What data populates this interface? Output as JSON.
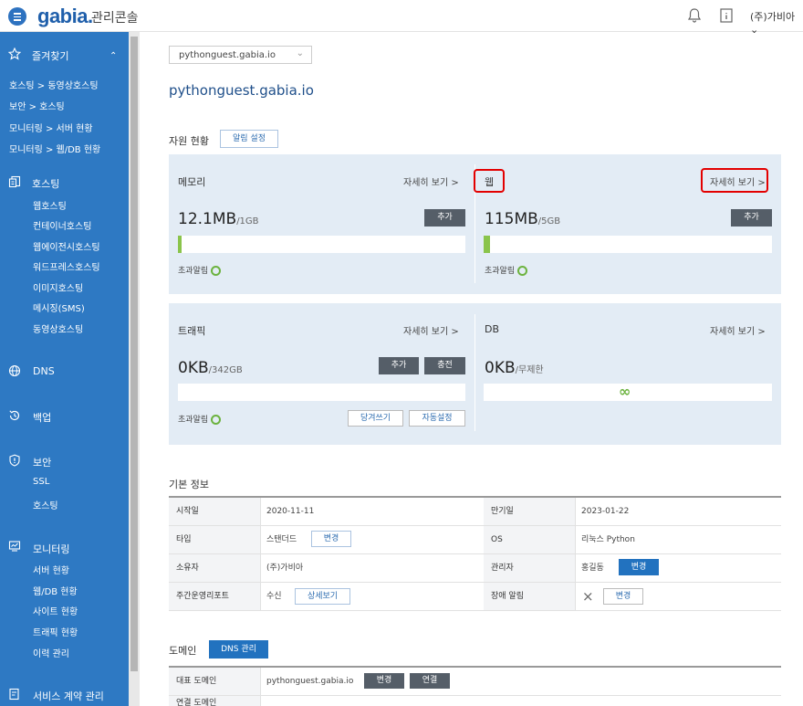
{
  "header": {
    "logo": "gabia.",
    "app_title": "관리콘솔",
    "user": "(주)가비아"
  },
  "sidebar": {
    "favorites": {
      "label": "즐겨찾기",
      "items": [
        "호스팅 > 동영상호스팅",
        "보안 > 호스팅",
        "모니터링 > 서버 현황",
        "모니터링 > 웹/DB 현황"
      ]
    },
    "hosting": {
      "label": "호스팅",
      "items": [
        "웹호스팅",
        "컨테이너호스팅",
        "웹에이전시호스팅",
        "워드프레스호스팅",
        "이미지호스팅",
        "메시징(SMS)",
        "동영상호스팅"
      ]
    },
    "dns": {
      "label": "DNS"
    },
    "backup": {
      "label": "백업"
    },
    "security": {
      "label": "보안",
      "items": [
        "SSL",
        "호스팅"
      ]
    },
    "monitoring": {
      "label": "모니터링",
      "items": [
        "서버 현황",
        "웹/DB 현황",
        "사이트 현황",
        "트래픽 현황",
        "이력 관리"
      ]
    },
    "contract": {
      "label": "서비스 계약 관리"
    }
  },
  "main": {
    "site_select": "pythonguest.gabia.io",
    "page_title": "pythonguest.gabia.io",
    "resources": {
      "title": "자원 현황",
      "alarm_settings": "알림 설정",
      "detail_link": "자세히 보기 >",
      "memory": {
        "label": "메모리",
        "value": "12.1MB",
        "limit": "/1GB",
        "add": "추가",
        "alarm": "초과알림",
        "usage": 0.012
      },
      "web": {
        "label": "웹",
        "value": "115MB",
        "limit": "/5GB",
        "add": "추가",
        "alarm": "초과알림",
        "usage": 0.023
      },
      "traffic": {
        "label": "트래픽",
        "value": "0KB",
        "limit": "/342GB",
        "add": "추가",
        "charge": "충전",
        "alarm": "초과알림",
        "borrow": "당겨쓰기",
        "auto": "자동설정"
      },
      "db": {
        "label": "DB",
        "value": "0KB",
        "limit": "/무제한",
        "infinity": "∞"
      }
    },
    "basic_info": {
      "title": "기본 정보",
      "rows": [
        {
          "k1": "시작일",
          "v1": "2020-11-11",
          "k2": "만기일",
          "v2": "2023-01-22"
        },
        {
          "k1": "타입",
          "v1": "스탠더드",
          "btn1": "변경",
          "k2": "OS",
          "v2": "리눅스 Python"
        },
        {
          "k1": "소유자",
          "v1": "(주)가비아",
          "k2": "관리자",
          "v2": "홍길동",
          "btn2": "변경"
        },
        {
          "k1": "주간운영리포트",
          "v1": "수신",
          "btn1": "상세보기",
          "k2": "장애 알림",
          "v2": "×",
          "btn2": "변경"
        }
      ]
    },
    "domain": {
      "title": "도메인",
      "dns_button": "DNS 관리",
      "rows": [
        {
          "k": "대표 도메인",
          "v": "pythonguest.gabia.io",
          "change": "변경",
          "connect": "연결"
        },
        {
          "k": "연결 도메인"
        }
      ]
    }
  },
  "colors": {
    "brand": "#2e79c3",
    "accent": "#2272bf",
    "panel": "#e3ecf5",
    "highlight": "#e30000",
    "usage": "#8ac44b"
  }
}
